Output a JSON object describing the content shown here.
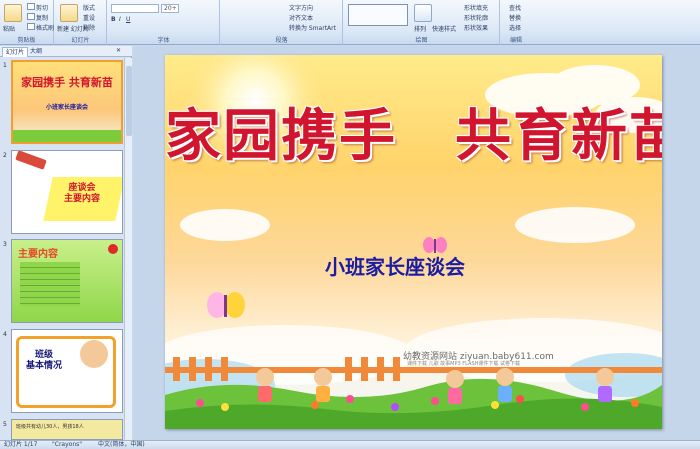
{
  "ribbon": {
    "clipboard": {
      "paste": "粘贴",
      "cut": "剪切",
      "copy": "复制",
      "format_painter": "格式刷",
      "label": "剪贴板"
    },
    "slides": {
      "new_slide": "新建\n幻灯片",
      "layout": "版式",
      "reset": "重设",
      "delete": "删除",
      "label": "幻灯片"
    },
    "font": {
      "size": "20+",
      "label": "字体"
    },
    "paragraph": {
      "text_direction": "文字方向",
      "align_text": "对齐文本",
      "convert_smartart": "转换为 SmartArt",
      "label": "段落"
    },
    "drawing": {
      "arrange": "排列",
      "quick_styles": "快速样式",
      "shape_fill": "形状填充",
      "shape_outline": "形状轮廓",
      "shape_effects": "形状效果",
      "label": "绘图"
    },
    "editing": {
      "find": "查找",
      "replace": "替换",
      "select": "选择",
      "label": "编辑"
    }
  },
  "panel": {
    "tabs": [
      "幻灯片",
      "大纲"
    ],
    "thumbnails": [
      {
        "num": "1",
        "title": "家园携手 共育新苗",
        "subtitle": "小班家长座谈会"
      },
      {
        "num": "2",
        "title": "座谈会\n主要内容"
      },
      {
        "num": "3",
        "title": "主要内容"
      },
      {
        "num": "4",
        "title": "班级\n基本情况"
      },
      {
        "num": "5",
        "title": "班级共有幼儿30人，男孩18人"
      }
    ]
  },
  "slide": {
    "title": "家园携手　共育新苗",
    "subtitle": "小班家长座谈会",
    "watermark": "幼教资源网站  ziyuan.baby611.com",
    "watermark_small": "课件下载  儿歌  故事MP3  FLASH课件下载  试卷下载"
  },
  "status": {
    "slide_info": "幻灯片 1/17",
    "theme": "\"Crayons\"",
    "language": "中文(简体，中国)"
  },
  "colors": {
    "title_red": "#d2152e",
    "subtitle_blue": "#1c1ca3",
    "ribbon_bg": "#dce8f6"
  }
}
